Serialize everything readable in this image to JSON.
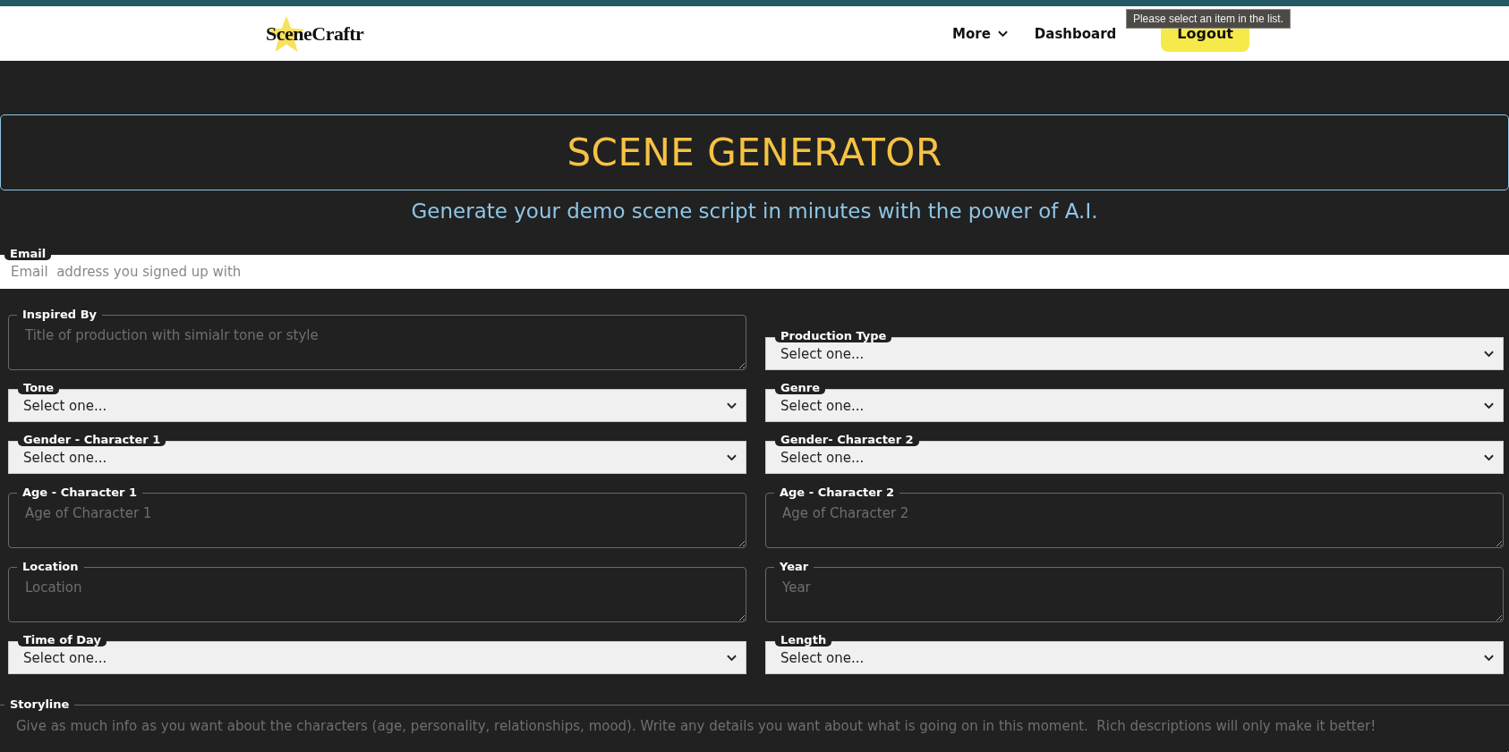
{
  "header": {
    "logo": "SceneCraftr",
    "nav": [
      {
        "label": "More",
        "kind": "dropdown"
      },
      {
        "label": "Dashboard",
        "kind": "link"
      }
    ],
    "button": "Logout",
    "tooltip": "Please select an item in the list."
  },
  "title": "SCENE GENERATOR",
  "subtitle": "Generate your demo scene script in minutes with the power of A.I.",
  "email": {
    "label": "Email",
    "placeholder": "Email  address you signed up with"
  },
  "rows": [
    [
      {
        "kind": "textarea",
        "label": "Inspired By",
        "placeholder": "Title of production with simialr tone or style"
      },
      {
        "kind": "select",
        "label": "Production Type",
        "value": "Select one..."
      }
    ],
    [
      {
        "kind": "select",
        "label": "Tone",
        "value": "Select one..."
      },
      {
        "kind": "select",
        "label": "Genre",
        "value": "Select one..."
      }
    ],
    [
      {
        "kind": "select",
        "label": "Gender - Character 1",
        "value": "Select one..."
      },
      {
        "kind": "select",
        "label": "Gender- Character 2",
        "value": "Select one..."
      }
    ],
    [
      {
        "kind": "textarea",
        "label": "Age - Character 1",
        "placeholder": "Age of Character 1"
      },
      {
        "kind": "textarea",
        "label": "Age - Character 2",
        "placeholder": "Age of Character 2"
      }
    ],
    [
      {
        "kind": "textarea",
        "label": "Location",
        "placeholder": "Location"
      },
      {
        "kind": "textarea",
        "label": "Year",
        "placeholder": "Year"
      }
    ],
    [
      {
        "kind": "select",
        "label": "Time of Day",
        "value": "Select one..."
      },
      {
        "kind": "select",
        "label": "Length",
        "value": "Select one..."
      }
    ]
  ],
  "storyline": {
    "label": "Storyline",
    "placeholder": "Give as much info as you want about the characters (age, personality, relationships, mood). Write any details you want about what is going on in this moment.  Rich descriptions will only make it better!"
  }
}
